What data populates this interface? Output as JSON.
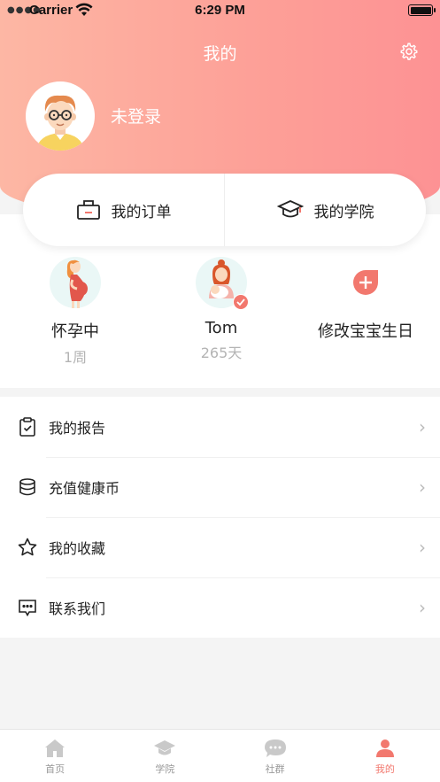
{
  "status_bar": {
    "carrier": "Carrier",
    "time": "6:29 PM"
  },
  "header": {
    "title": "我的",
    "login_status": "未登录"
  },
  "quick_actions": {
    "orders_label": "我的订单",
    "academy_label": "我的学院"
  },
  "babies": [
    {
      "name": "怀孕中",
      "sub": "1周"
    },
    {
      "name": "Tom",
      "sub": "265天"
    },
    {
      "name": "修改宝宝生日",
      "sub": ""
    }
  ],
  "menu": [
    {
      "label": "我的报告",
      "icon": "report-icon"
    },
    {
      "label": "充值健康币",
      "icon": "coins-icon"
    },
    {
      "label": "我的收藏",
      "icon": "star-icon"
    },
    {
      "label": "联系我们",
      "icon": "chat-icon"
    }
  ],
  "tabbar": [
    {
      "label": "首页",
      "icon": "home-icon"
    },
    {
      "label": "学院",
      "icon": "graduation-cap-icon"
    },
    {
      "label": "社群",
      "icon": "chat-bubble-icon"
    },
    {
      "label": "我的",
      "icon": "person-icon",
      "active": true
    }
  ],
  "colors": {
    "accent": "#f2786e",
    "header_start": "#fdb7a4",
    "header_end": "#fd9294"
  }
}
